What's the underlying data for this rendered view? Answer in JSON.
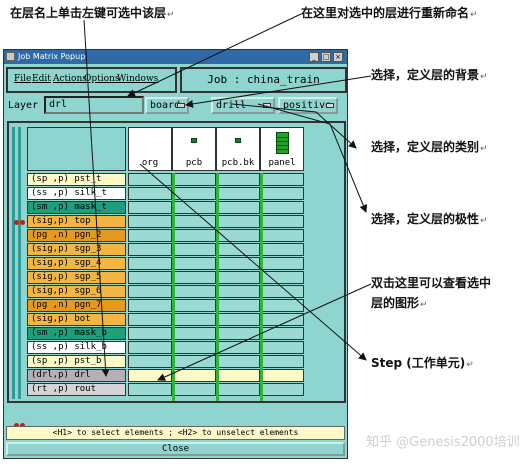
{
  "annotations": {
    "select_layer": "在层名上单击左键可选中该层",
    "rename_layer": "在这里对选中的层进行重新命名",
    "context": "选择，定义层的背景",
    "type": "选择，定义层的类别",
    "polarity": "选择，定义层的极性",
    "view_graphics_1": "双击这里可以查看选中",
    "view_graphics_2": "层的图形",
    "step": "Step (工作单元)",
    "mark": "↵"
  },
  "window": {
    "title": "Job Matrix Popup",
    "btn_min": "_",
    "btn_max": "□",
    "btn_close": "×"
  },
  "menu": {
    "file": "File",
    "edit": "Edit",
    "actions": "Actions",
    "options": "Options",
    "windows": "Windows"
  },
  "job": {
    "label": "Job : china_train"
  },
  "layer_bar": {
    "label": "Layer :",
    "value": "drl",
    "context": "board",
    "type": "drill",
    "polarity": "positive"
  },
  "steps": [
    "org",
    "pcb",
    "pcb.bk",
    "panel"
  ],
  "layers": [
    {
      "name": "(sp ,p) pst_t",
      "color": "#fff9c8"
    },
    {
      "name": "(ss ,p) silk_t",
      "color": "#ffffff"
    },
    {
      "name": "(sm ,p) mask_t",
      "color": "#1f9e7a"
    },
    {
      "name": "(sig,p) top",
      "color": "#f4b640"
    },
    {
      "name": "(pg ,n) pgn_2",
      "color": "#e59a1f"
    },
    {
      "name": "(sig,p) sgp_3",
      "color": "#f4b640"
    },
    {
      "name": "(sig,p) sgp_4",
      "color": "#f4b640"
    },
    {
      "name": "(sig,p) sgp_5",
      "color": "#f4b640"
    },
    {
      "name": "(sig,p) sgp_6",
      "color": "#f4b640"
    },
    {
      "name": "(pg ,n) pgn_7",
      "color": "#e59a1f"
    },
    {
      "name": "(sig,p) bot",
      "color": "#f4b640"
    },
    {
      "name": "(sm ,p) mask_b",
      "color": "#1f9e7a"
    },
    {
      "name": "(ss ,p) silk_b",
      "color": "#ffffff"
    },
    {
      "name": "(sp ,p) pst_b",
      "color": "#fff9c8"
    },
    {
      "name": "(drl,p) drl",
      "color": "#b8aeb8"
    },
    {
      "name": "(rt ,p) rout",
      "color": "#d6d3d6"
    }
  ],
  "status": {
    "text": "<H1> to select elements ; <H2> to unselect elements"
  },
  "close_label": "Close",
  "watermark": "知乎 @Genesis2000培训"
}
